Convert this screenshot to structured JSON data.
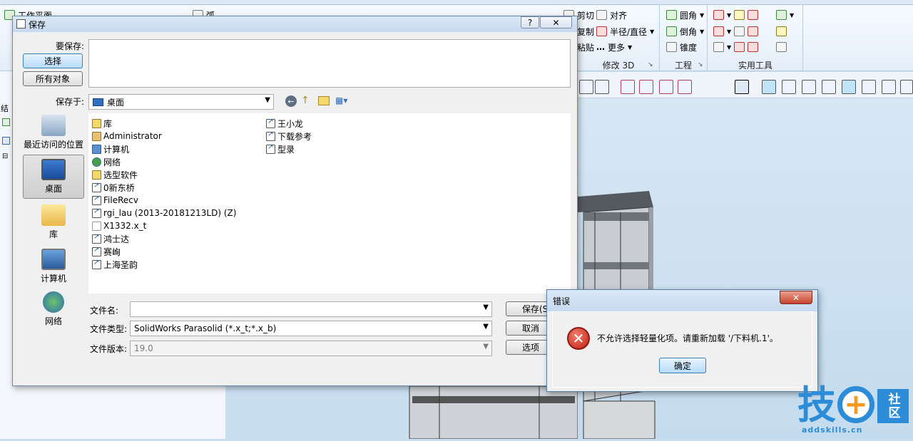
{
  "ribbon": {
    "tab_fragments": [
      "工作平面",
      "弧"
    ],
    "panel_labels": [
      "剪切",
      "复制",
      "粘贴",
      "对齐",
      "半径/直径",
      "更多",
      "圆角",
      "倒角",
      "锥度"
    ],
    "groups": [
      "修改 3D",
      "工程",
      "实用工具"
    ]
  },
  "left_panel": {
    "title_fragment": "结"
  },
  "save_dialog": {
    "title": "保存",
    "help_label": "?",
    "close_label": "✕",
    "to_save_label": "要保存:",
    "select_button": "选择",
    "all_objects_button": "所有对象",
    "save_in_label": "保存于:",
    "save_in_value": "桌面",
    "places": [
      {
        "label": "最近访问的位置",
        "icon": "recent-places-icon"
      },
      {
        "label": "桌面",
        "icon": "desktop-icon",
        "selected": true
      },
      {
        "label": "库",
        "icon": "libraries-icon"
      },
      {
        "label": "计算机",
        "icon": "computer-icon"
      },
      {
        "label": "网络",
        "icon": "network-icon"
      }
    ],
    "files_col1": [
      {
        "name": "库",
        "icon": "library"
      },
      {
        "name": "Administrator",
        "icon": "user"
      },
      {
        "name": "计算机",
        "icon": "computer"
      },
      {
        "name": "网络",
        "icon": "network"
      },
      {
        "name": "选型软件",
        "icon": "folder"
      },
      {
        "name": "0新东桥",
        "icon": "shortcut"
      },
      {
        "name": "FileRecv",
        "icon": "shortcut"
      },
      {
        "name": "rgi_lau (2013-20181213LD) (Z)",
        "icon": "shortcut"
      },
      {
        "name": "X1332.x_t",
        "icon": "document"
      },
      {
        "name": "鸿士达",
        "icon": "shortcut"
      },
      {
        "name": "赛峋",
        "icon": "shortcut"
      },
      {
        "name": "上海圣韵",
        "icon": "shortcut"
      }
    ],
    "files_col2": [
      {
        "name": "王小龙",
        "icon": "shortcut"
      },
      {
        "name": "下载参考",
        "icon": "shortcut"
      },
      {
        "name": "型录",
        "icon": "shortcut"
      }
    ],
    "filename_label": "文件名:",
    "filename_value": "",
    "filetype_label": "文件类型:",
    "filetype_value": "SolidWorks Parasolid (*.x_t;*.x_b)",
    "version_label": "文件版本:",
    "version_value": "19.0",
    "save_button": "保存(S",
    "cancel_button": "取消",
    "options_button": "选项"
  },
  "error_dialog": {
    "title": "错误",
    "close_label": "✕",
    "message": "不允许选择轻量化项。请重新加载 '/下料机.1'。",
    "ok_button": "确定"
  },
  "watermark": {
    "main": "技",
    "badge": "社区",
    "url": "addskills.cn"
  },
  "colors": {
    "accent_blue": "#2d8cd8",
    "watermark_orange": "#f39a1e",
    "error_red": "#c21e12"
  }
}
